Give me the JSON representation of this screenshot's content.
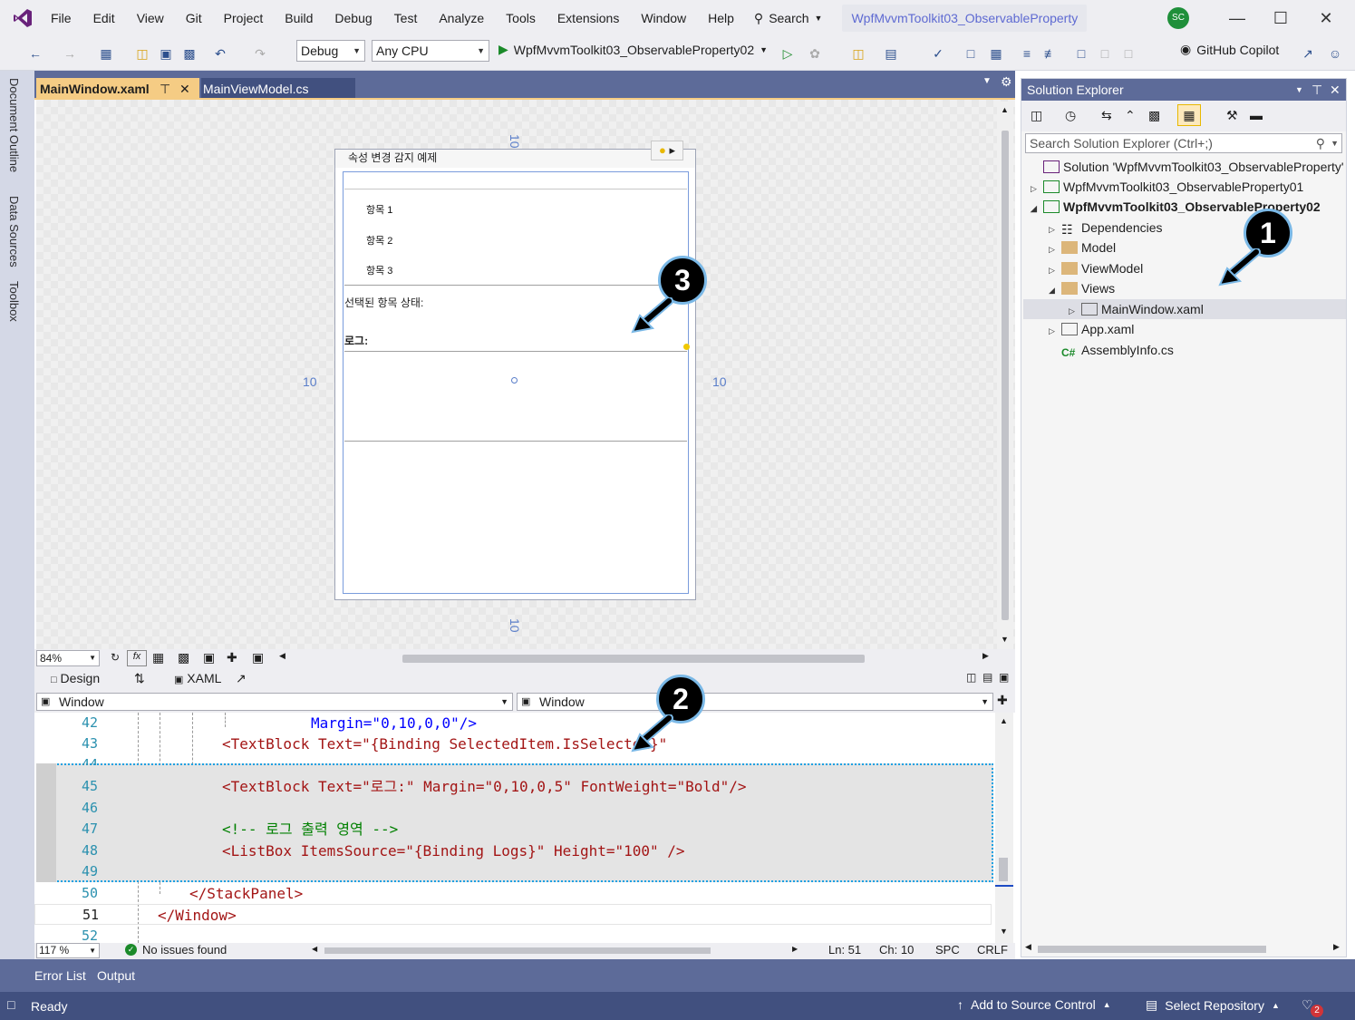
{
  "menu": {
    "items": [
      "File",
      "Edit",
      "View",
      "Git",
      "Project",
      "Build",
      "Debug",
      "Test",
      "Analyze",
      "Tools",
      "Extensions",
      "Window",
      "Help"
    ],
    "search_label": "Search",
    "title_tab": "WpfMvvmToolkit03_ObservableProperty",
    "avatar_initials": "SC"
  },
  "toolbar": {
    "config": "Debug",
    "platform": "Any CPU",
    "start_target": "WpfMvvmToolkit03_ObservableProperty02",
    "copilot_label": "GitHub Copilot"
  },
  "left_strip": {
    "tabs": [
      "Document Outline",
      "Data Sources",
      "Toolbox"
    ]
  },
  "doc_tabs": {
    "active": "MainWindow.xaml",
    "other": "MainViewModel.cs"
  },
  "designer": {
    "window_title": "속성 변경 감지 예제",
    "list_items": [
      "항목 1",
      "항목 2",
      "항목 3"
    ],
    "selected_status_label": "선택된 항목 상태:",
    "log_label": "로그:",
    "margins": [
      "10",
      "10",
      "10",
      "10"
    ],
    "zoom": "84%"
  },
  "split": {
    "design_label": "Design",
    "xaml_label": "XAML"
  },
  "nav": {
    "left": "Window",
    "right": "Window"
  },
  "code_lines": [
    {
      "n": "42",
      "text": "Margin=\"0,10,0,0\"/>"
    },
    {
      "n": "43",
      "text": "<TextBlock Text=\"{Binding SelectedItem.IsSelected}\""
    },
    {
      "n": "44",
      "text": ""
    },
    {
      "n": "45",
      "text": "<TextBlock Text=\"로그:\" Margin=\"0,10,0,5\" FontWeight=\"Bold\"/>"
    },
    {
      "n": "46",
      "text": ""
    },
    {
      "n": "47",
      "text": "<!-- 로그 출력 영역 -->"
    },
    {
      "n": "48",
      "text": "<ListBox ItemsSource=\"{Binding Logs}\" Height=\"100\" />"
    },
    {
      "n": "49",
      "text": ""
    },
    {
      "n": "50",
      "text": "</StackPanel>"
    },
    {
      "n": "51",
      "text": "</Window>"
    },
    {
      "n": "52",
      "text": ""
    }
  ],
  "editor_status": {
    "zoom": "117 %",
    "issues": "No issues found",
    "line": "Ln: 51",
    "col": "Ch: 10",
    "ws": "SPC",
    "eol": "CRLF"
  },
  "solution_explorer": {
    "title": "Solution Explorer",
    "search_placeholder": "Search Solution Explorer (Ctrl+;)",
    "items": [
      {
        "label": "Solution 'WpfMvvmToolkit03_ObservableProperty'",
        "bold": false
      },
      {
        "label": "WpfMvvmToolkit03_ObservableProperty01",
        "bold": false
      },
      {
        "label": "WpfMvvmToolkit03_ObservableProperty02",
        "bold": true
      },
      {
        "label": "Dependencies",
        "bold": false
      },
      {
        "label": "Model",
        "bold": false
      },
      {
        "label": "ViewModel",
        "bold": false
      },
      {
        "label": "Views",
        "bold": false
      },
      {
        "label": "MainWindow.xaml",
        "bold": false
      },
      {
        "label": "App.xaml",
        "bold": false
      },
      {
        "label": "AssemblyInfo.cs",
        "bold": false
      }
    ]
  },
  "bottom_tabs": [
    "Error List",
    "Output"
  ],
  "status": {
    "ready": "Ready",
    "source_control": "Add to Source Control",
    "repo": "Select Repository",
    "notifications": "2"
  },
  "annotations": [
    "1",
    "2",
    "3"
  ],
  "colors": {
    "accent": "#5d6b99",
    "tab_active": "#f5cc84",
    "status_bar": "#41507f",
    "badge_ring": "#7ab8e6"
  }
}
